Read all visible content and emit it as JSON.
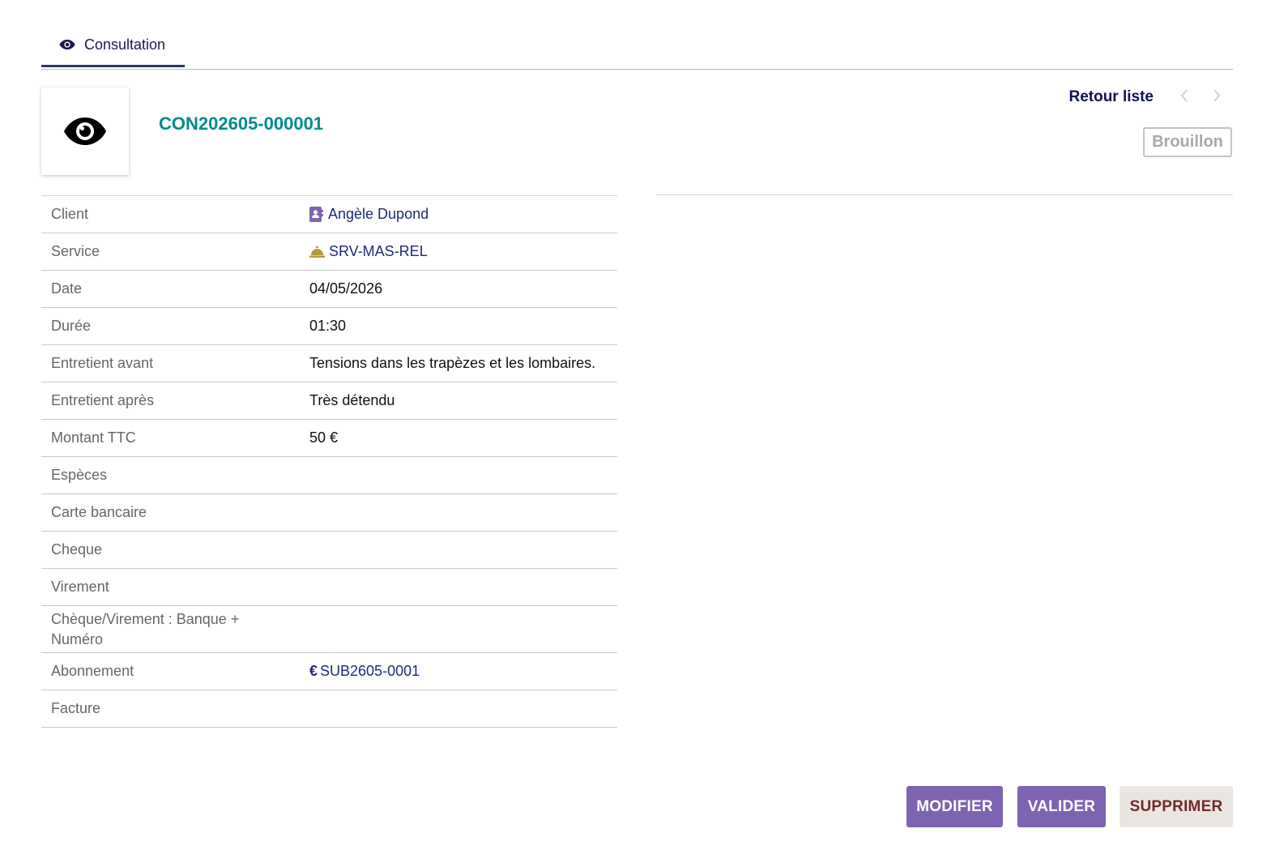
{
  "tabs": [
    {
      "label": "Consultation",
      "icon": "eye-icon",
      "active": true
    }
  ],
  "header": {
    "ref": "CON202605-000001",
    "back_label": "Retour liste",
    "status": "Brouillon"
  },
  "fields": {
    "client": {
      "label": "Client",
      "value": "Angèle Dupond",
      "icon": "contact-card-icon"
    },
    "service": {
      "label": "Service",
      "value": "SRV-MAS-REL",
      "icon": "service-bell-icon"
    },
    "date": {
      "label": "Date",
      "value": "04/05/2026"
    },
    "duree": {
      "label": "Durée",
      "value": "01:30"
    },
    "entretient_avant": {
      "label": "Entretient avant",
      "value": "Tensions dans les trapèzes et les lombaires."
    },
    "entretient_apres": {
      "label": "Entretient après",
      "value": "Très détendu"
    },
    "montant": {
      "label": "Montant TTC",
      "value": "50 €"
    },
    "especes": {
      "label": "Espèces",
      "value": ""
    },
    "carte": {
      "label": "Carte bancaire",
      "value": ""
    },
    "cheque": {
      "label": "Cheque",
      "value": ""
    },
    "virement": {
      "label": "Virement",
      "value": ""
    },
    "banque": {
      "label": "Chèque/Virement : Banque + Numéro",
      "value": ""
    },
    "abonnement": {
      "label": "Abonnement",
      "value": "SUB2605-0001",
      "icon": "euro-icon"
    },
    "facture": {
      "label": "Facture",
      "value": ""
    }
  },
  "actions": {
    "modify": "MODIFIER",
    "validate": "VALIDER",
    "delete": "SUPPRIMER"
  },
  "colors": {
    "accent": "#7d63b1",
    "ref": "#008b8b",
    "link": "#1e2a78",
    "delete_text": "#702a2a"
  }
}
